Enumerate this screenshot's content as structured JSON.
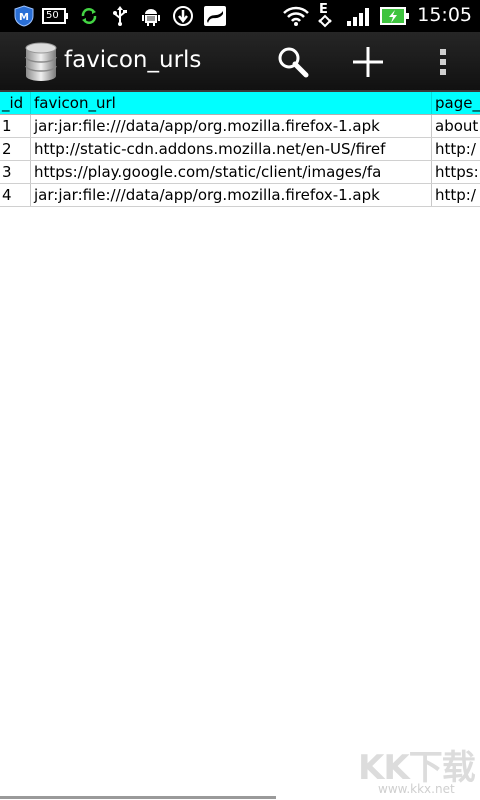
{
  "status_bar": {
    "time": "15:05",
    "battery_badge": "50",
    "network_letter": "E",
    "icons": [
      "shield-icon",
      "battery-saver-icon",
      "sync-icon",
      "usb-icon",
      "android-debug-icon",
      "download-icon",
      "app-notification-icon",
      "wifi-icon",
      "edge-network-icon",
      "signal-icon",
      "battery-charging-icon"
    ]
  },
  "action_bar": {
    "title": "favicon_urls",
    "icons": [
      "database-icon",
      "search-icon",
      "add-icon",
      "overflow-menu-icon"
    ]
  },
  "table": {
    "columns": [
      "_id",
      "favicon_url",
      "page_"
    ],
    "rows": [
      [
        "1",
        "jar:jar:file:///data/app/org.mozilla.firefox-1.apk",
        "about"
      ],
      [
        "2",
        "http://static-cdn.addons.mozilla.net/en-US/firef",
        "http:/"
      ],
      [
        "3",
        "https://play.google.com/static/client/images/fa",
        "https:"
      ],
      [
        "4",
        "jar:jar:file:///data/app/org.mozilla.firefox-1.apk",
        "http:/"
      ]
    ]
  },
  "watermark": {
    "main": "KK下载",
    "sub": "www.kkx.net"
  },
  "colors": {
    "header_bg": "#00ffff",
    "status_bar_bg": "#000000",
    "action_bar_bg": "#1c1c1c",
    "battery_green": "#3fc43f"
  }
}
